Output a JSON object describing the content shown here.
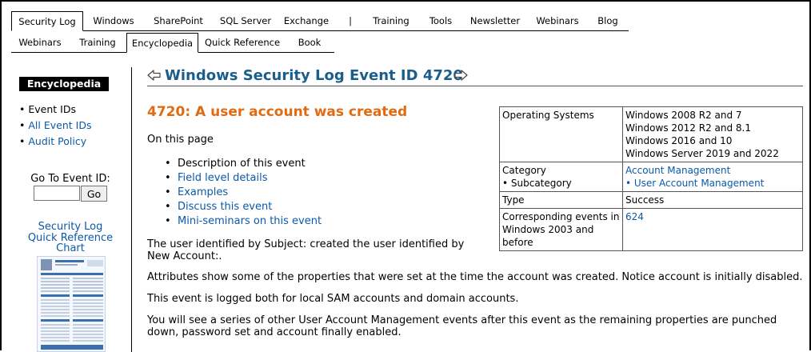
{
  "nav": {
    "row1": [
      "Security Log",
      "Windows",
      "SharePoint",
      "SQL Server",
      "Exchange",
      "|",
      "Training",
      "Tools",
      "Newsletter",
      "Webinars",
      "Blog"
    ],
    "row2": [
      "Webinars",
      "Training",
      "Encyclopedia",
      "Quick Reference",
      "Book"
    ],
    "row1_active": "Security Log",
    "row2_active": "Encyclopedia"
  },
  "sidebar": {
    "badge": "Encyclopedia",
    "items": [
      {
        "label": "Event IDs",
        "link": false
      },
      {
        "label": "All Event IDs",
        "link": true
      },
      {
        "label": "Audit Policy",
        "link": true
      }
    ],
    "goto_label": "Go To Event ID:",
    "goto_value": "",
    "goto_button": "Go",
    "quickref": "Security Log Quick Reference Chart",
    "quickref_thumb_icon": "quick-reference-chart-thumbnail"
  },
  "main": {
    "title": "Windows Security Log Event ID 4720",
    "prev_icon": "arrow-left-icon",
    "next_icon": "arrow-right-icon",
    "heading": "4720: A user account was created",
    "on_this_page": "On this page",
    "toc": [
      {
        "label": "Description of this event",
        "link": false
      },
      {
        "label": "Field level details",
        "link": true
      },
      {
        "label": "Examples",
        "link": true
      },
      {
        "label": "Discuss this event",
        "link": true
      },
      {
        "label": "Mini-seminars on this event",
        "link": true
      }
    ],
    "paragraphs": [
      "The user identified by Subject: created the user identified by New Account:.",
      "Attributes show some of the properties that were set at the time the account was created.  Notice account is initially disabled.",
      "This event is logged both for local SAM accounts and domain accounts.",
      "You will see a series of other User Account Management events after this event as the remaining properties are punched down, password set and account finally enabled."
    ]
  },
  "info_table": {
    "os_label": "Operating Systems",
    "os_values": [
      "Windows 2008 R2 and 7",
      "Windows 2012 R2 and 8.1",
      "Windows 2016 and 10",
      "Windows Server 2019 and 2022"
    ],
    "category_label": "Category",
    "subcategory_label": "• Subcategory",
    "category_value": "Account Management",
    "subcategory_value": "• User Account Management",
    "type_label": "Type",
    "type_value": "Success",
    "corr_label": "Corresponding events in Windows 2003 and before",
    "corr_value": "624"
  },
  "colors": {
    "title": "#1b5e8c",
    "heading": "#e06b13",
    "link": "#0b59a8"
  }
}
